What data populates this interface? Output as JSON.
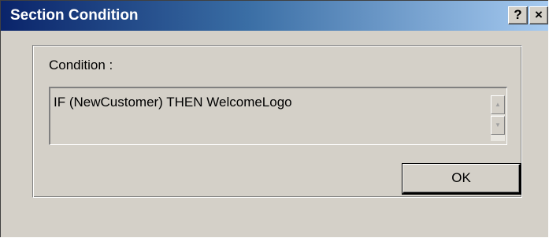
{
  "window": {
    "title": "Section Condition",
    "help_label": "?",
    "close_label": "×"
  },
  "condition": {
    "label": "Condition :",
    "value": "IF (NewCustomer) THEN WelcomeLogo",
    "scroll_up_icon": "▲",
    "scroll_down_icon": "▼"
  },
  "buttons": {
    "ok_label": "OK"
  },
  "colors": {
    "titlebar_start": "#0a246a",
    "titlebar_end": "#a6caf0",
    "face": "#d4d0c8"
  }
}
